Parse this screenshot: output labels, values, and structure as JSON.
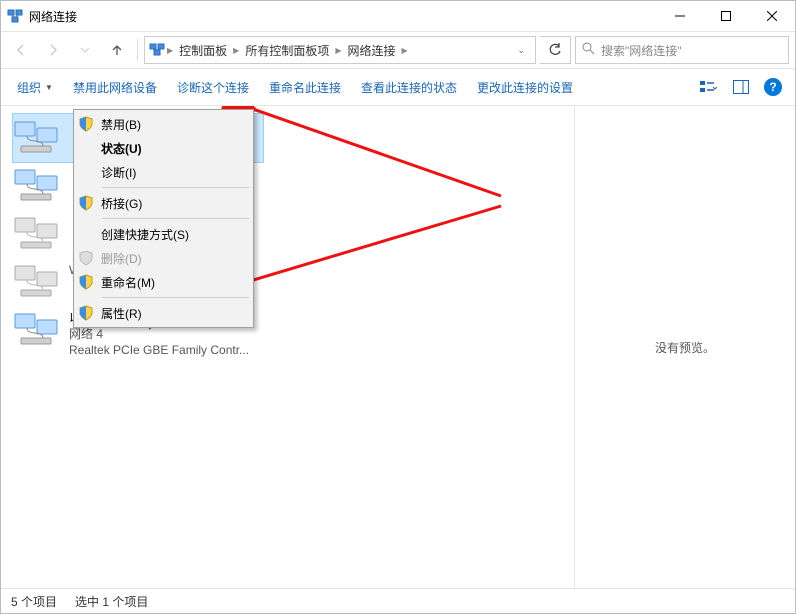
{
  "window": {
    "title": "网络连接"
  },
  "breadcrumb": {
    "l1": "控制面板",
    "l2": "所有控制面板项",
    "l3": "网络连接"
  },
  "search": {
    "placeholder": "搜索\"网络连接\""
  },
  "toolbar": {
    "organize": "组织",
    "disable": "禁用此网络设备",
    "diagnose": "诊断这个连接",
    "rename": "重命名此连接",
    "view_status": "查看此连接的状态",
    "change_settings": "更改此连接的设置"
  },
  "context_menu": {
    "disable": "禁用(B)",
    "status": "状态(U)",
    "diagnose": "诊断(I)",
    "bridge": "桥接(G)",
    "shortcut": "创建快捷方式(S)",
    "delete": "删除(D)",
    "rename": "重命名(M)",
    "properties": "属性(R)"
  },
  "items": [
    {
      "name": "",
      "sub": "",
      "desc": ""
    },
    {
      "name": "",
      "sub": "",
      "desc": ""
    },
    {
      "name": "",
      "sub": "",
      "desc": ""
    },
    {
      "name": "",
      "sub": "WAN Miniport (PPTP)",
      "desc": ""
    },
    {
      "name": "以太网",
      "sub": "网络 4",
      "desc": "Realtek PCIe GBE Family Contr..."
    }
  ],
  "preview": {
    "empty": "没有预览。"
  },
  "status": {
    "count": "5 个项目",
    "selected": "选中 1 个项目"
  }
}
